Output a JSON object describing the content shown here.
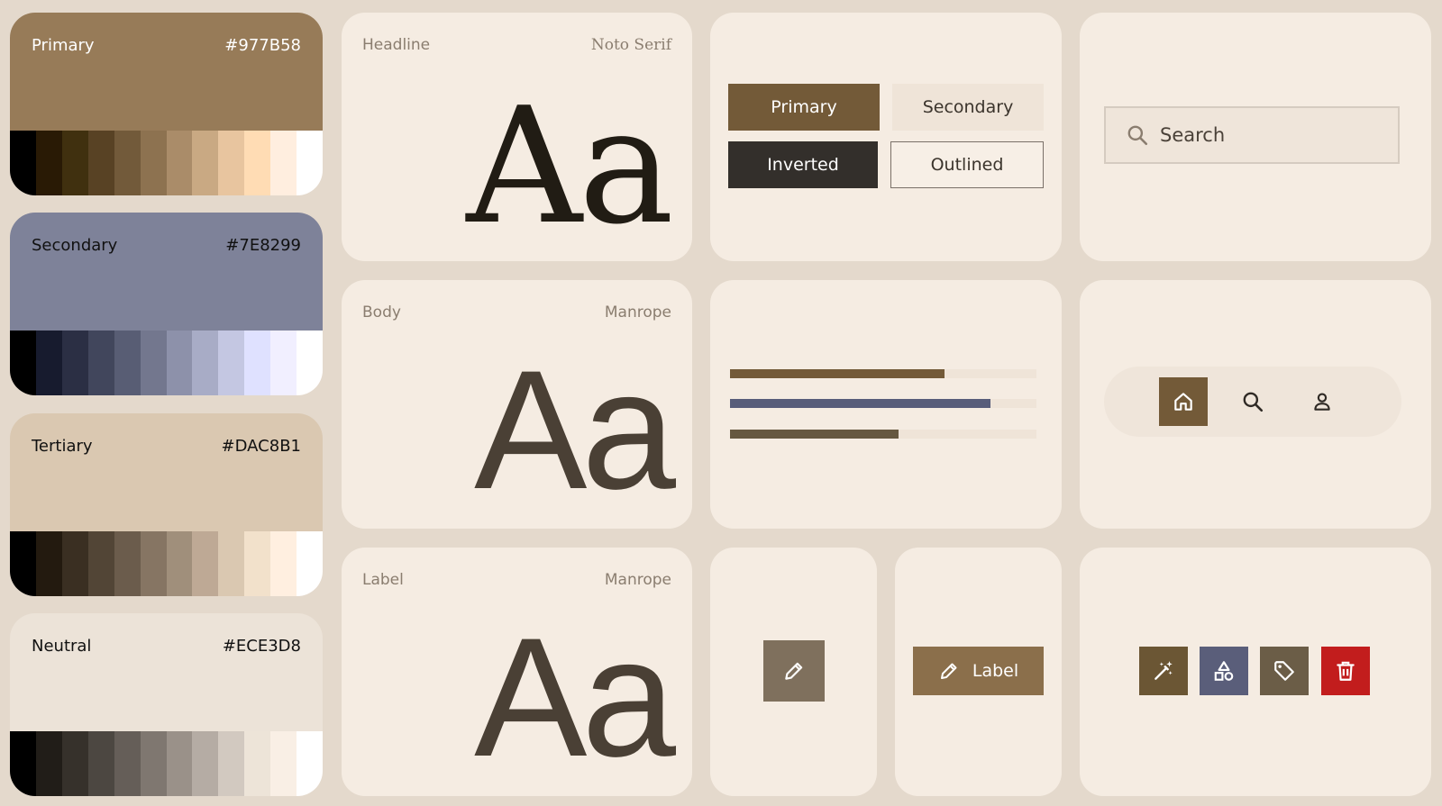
{
  "palette": [
    {
      "name": "Primary",
      "hex": "#977B58",
      "base": "#977b58",
      "text": "#ffffff",
      "tones": [
        "#000000",
        "#291a05",
        "#40300f",
        "#584224",
        "#725a3a",
        "#8d7250",
        "#aa8c69",
        "#c9a983",
        "#e8c59f",
        "#ffdcb4",
        "#ffeedf",
        "#ffffff"
      ]
    },
    {
      "name": "Secondary",
      "hex": "#7E8299",
      "base": "#7e8299",
      "text": "#111111",
      "tones": [
        "#000000",
        "#171b2e",
        "#2b2f44",
        "#41465c",
        "#585d74",
        "#73778e",
        "#8d91aa",
        "#a8acc6",
        "#c4c7e2",
        "#dfe1ff",
        "#f1efff",
        "#ffffff"
      ]
    },
    {
      "name": "Tertiary",
      "hex": "#DAC8B1",
      "base": "#dac8b1",
      "text": "#111111",
      "tones": [
        "#000000",
        "#231a0f",
        "#3a2f22",
        "#524536",
        "#6b5c4c",
        "#867563",
        "#a08f7b",
        "#bea995",
        "#dac8b1",
        "#f2e1cb",
        "#ffefe0",
        "#ffffff"
      ]
    },
    {
      "name": "Neutral",
      "hex": "#ECE3D8",
      "base": "#ece3d8",
      "text": "#111111",
      "tones": [
        "#000000",
        "#211d18",
        "#36312b",
        "#4c4741",
        "#655e58",
        "#7f7770",
        "#9a9189",
        "#b5aca4",
        "#d2c9c0",
        "#ede4d8",
        "#f9efe5",
        "#ffffff"
      ]
    }
  ],
  "typography": [
    {
      "role": "Headline",
      "font": "Noto Serif",
      "sample": "Aa"
    },
    {
      "role": "Body",
      "font": "Manrope",
      "sample": "Aa"
    },
    {
      "role": "Label",
      "font": "Manrope",
      "sample": "Aa"
    }
  ],
  "buttons": {
    "primary": "Primary",
    "secondary": "Secondary",
    "inverted": "Inverted",
    "outlined": "Outlined"
  },
  "search": {
    "placeholder": "Search"
  },
  "progress": [
    {
      "value": 0.7,
      "color": "#735a38"
    },
    {
      "value": 0.85,
      "color": "#585d7a"
    },
    {
      "value": 0.55,
      "color": "#665840"
    }
  ],
  "nav": {
    "active": "home",
    "items": [
      "home-icon",
      "search-icon",
      "person-icon"
    ]
  },
  "label_button": {
    "label": "Label"
  },
  "icon_buttons": [
    {
      "icon": "magic-wand-icon",
      "color": "#6b5634"
    },
    {
      "icon": "shapes-icon",
      "color": "#5a5e7a"
    },
    {
      "icon": "tag-icon",
      "color": "#6b5d47"
    },
    {
      "icon": "trash-icon",
      "color": "#c21d1d"
    }
  ]
}
